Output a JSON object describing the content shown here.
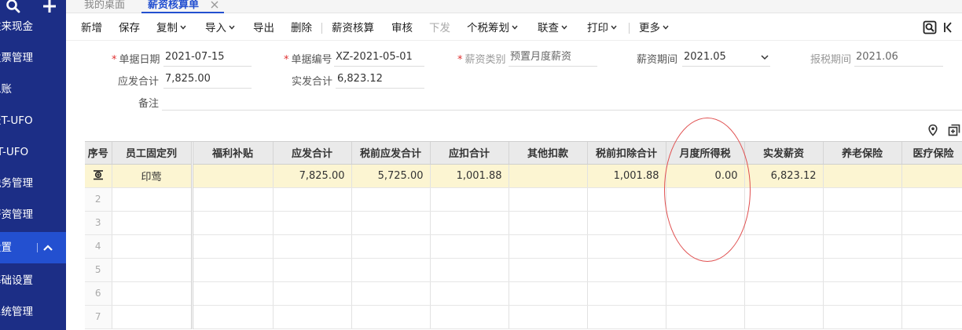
{
  "sidebar": {
    "items": [
      {
        "label": "往来现金"
      },
      {
        "label": "发票管理"
      },
      {
        "label": "总账"
      },
      {
        "label": "报T-UFO"
      },
      {
        "label": "T-UFO"
      },
      {
        "label": "税务管理"
      },
      {
        "label": "薪资管理"
      },
      {
        "label": "设置"
      },
      {
        "label": "基础设置"
      },
      {
        "label": "系统管理"
      }
    ]
  },
  "tabs": {
    "home": "我的桌面",
    "active": "薪资核算单"
  },
  "toolbar": {
    "new": "新增",
    "save": "保存",
    "copy": "复制",
    "import": "导入",
    "export": "导出",
    "delete": "删除",
    "calc": "薪资核算",
    "audit": "审核",
    "issue": "下发",
    "tax_plan": "个税筹划",
    "query": "联查",
    "print": "打印",
    "more": "更多"
  },
  "form": {
    "date_label": "单据日期",
    "date_value": "2021-07-15",
    "code_label": "单据编号",
    "code_value": "XZ-2021-05-01",
    "type_label": "薪资类别",
    "type_value": "预置月度薪资",
    "period_label": "薪资期间",
    "period_value": "2021.05",
    "tax_period_label": "报税期间",
    "tax_period_value": "2021.06",
    "gross_label": "应发合计",
    "gross_value": "7,825.00",
    "net_label": "实发合计",
    "net_value": "6,823.12",
    "remark_label": "备注",
    "remark_value": ""
  },
  "grid": {
    "headers": [
      "序号",
      "员工固定列",
      "福利补贴",
      "应发合计",
      "税前应发合计",
      "应扣合计",
      "其他扣款",
      "税前扣除合计",
      "月度所得税",
      "实发薪资",
      "养老保险",
      "医疗保险"
    ],
    "row1": {
      "employee": "印莺",
      "welfare": "",
      "gross": "7,825.00",
      "pretax_gross": "5,725.00",
      "deduct": "1,001.88",
      "other": "",
      "pretax_deduct": "1,001.88",
      "tax": "0.00",
      "net": "6,823.12",
      "pension": "",
      "medical": ""
    },
    "row_numbers": [
      "2",
      "3",
      "4",
      "5",
      "6",
      "7"
    ]
  },
  "colors": {
    "sidebar": "#1c2e86",
    "accent": "#2350d0",
    "selected_row": "#fcf5d2",
    "annotation": "#e05050"
  }
}
